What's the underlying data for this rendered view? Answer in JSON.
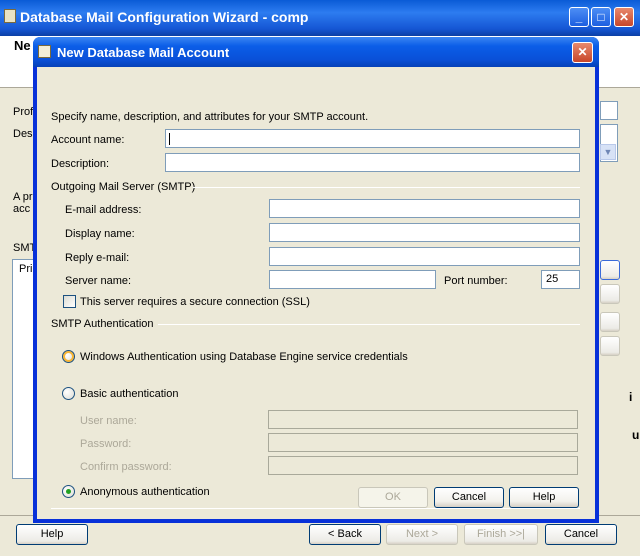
{
  "wizard": {
    "title": "Database Mail Configuration Wizard - comp",
    "header_fragment": "Ne",
    "labels": {
      "profile": "Prof",
      "description": "Des",
      "intro_line1": "A pr",
      "intro_line2": "acc",
      "smtp": "SMT",
      "table_header": "Prio"
    },
    "controls": {
      "minimize": "_",
      "maximize": "□",
      "close": "✕"
    },
    "buttons": {
      "help": "Help",
      "back": "< Back",
      "next": "Next >",
      "finish": "Finish >>|",
      "cancel": "Cancel"
    },
    "edge_fragments": {
      "i": "i",
      "u": "u"
    }
  },
  "dialog": {
    "title": "New Database Mail Account",
    "close": "✕",
    "instructions": "Specify name, description, and attributes for your SMTP account.",
    "account_name": {
      "label": "Account name:",
      "value": ""
    },
    "description": {
      "label": "Description:",
      "value": ""
    },
    "smtp_group": "Outgoing Mail Server (SMTP)",
    "email": {
      "label": "E-mail address:",
      "value": ""
    },
    "display_name": {
      "label": "Display name:",
      "value": ""
    },
    "reply_email": {
      "label": "Reply e-mail:",
      "value": ""
    },
    "server_name": {
      "label": "Server name:",
      "value": ""
    },
    "port": {
      "label": "Port number:",
      "value": "25"
    },
    "ssl": {
      "label": "This server requires a secure connection (SSL)",
      "checked": false
    },
    "auth_group": "SMTP Authentication",
    "auth_options": {
      "windows": "Windows Authentication using Database Engine service credentials",
      "basic": "Basic authentication",
      "anonymous": "Anonymous authentication"
    },
    "selected_auth": "anonymous",
    "user_name": {
      "label": "User name:",
      "value": ""
    },
    "password": {
      "label": "Password:",
      "value": ""
    },
    "confirm_password": {
      "label": "Confirm password:",
      "value": ""
    },
    "buttons": {
      "ok": "OK",
      "cancel": "Cancel",
      "help": "Help"
    }
  },
  "colors": {
    "title_bar": "#0a50d8",
    "face": "#ece9d8",
    "selected_radio": "#21a121"
  }
}
